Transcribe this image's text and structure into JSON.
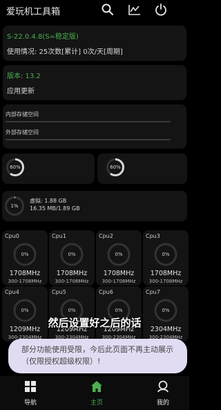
{
  "header": {
    "title": "爱玩机工具箱",
    "icons": [
      "search-icon",
      "chart-icon",
      "power-icon"
    ]
  },
  "info_card": {
    "version_line": "S-22.0.4.8(S=稳定版)",
    "usage_line": "使用情况: 25次数[累计] 0次/天[周期]"
  },
  "version_card": {
    "version": "版本: 13.2",
    "update": "应用更新"
  },
  "storage": {
    "internal_label": "内部存储空间",
    "external_label": "外部存储空间"
  },
  "usage_cards": {
    "left_percent": "60%",
    "right_percent": "60%"
  },
  "memory": {
    "percent": "1%",
    "virtual": "虚拟: 1.88 GB",
    "ram": "16.35 MB/1.89 GB"
  },
  "cpus": [
    {
      "name": "Cpu0",
      "load": "0%",
      "freq": "1708MHz",
      "range": "300-1708MHz"
    },
    {
      "name": "Cpu1",
      "load": "0%",
      "freq": "1708MHz",
      "range": "300-1708MHz"
    },
    {
      "name": "Cpu2",
      "load": "0%",
      "freq": "1708MHz",
      "range": "300-1708MHz"
    },
    {
      "name": "Cpu3",
      "load": "0%",
      "freq": "1708MHz",
      "range": "300-1708MHz"
    },
    {
      "name": "Cpu4",
      "load": "0%",
      "freq": "1209MHz",
      "range": "300-2304MHz"
    },
    {
      "name": "Cpu5",
      "load": "0%",
      "freq": "1209MHz",
      "range": "300-2304MHz"
    },
    {
      "name": "Cpu6",
      "load": "0%",
      "freq": "1209MHz",
      "range": "300-2304MHz"
    },
    {
      "name": "Cpu7",
      "load": "0%",
      "freq": "2304MHz",
      "range": "300-2304MHz"
    }
  ],
  "subtitle": "然后设置好之后的话",
  "toast": "部分功能使用受限，今后此页面不再主动展示（仅限授权超级权限）!",
  "bottom_nav": [
    {
      "label": "导航",
      "icon": "grid-icon"
    },
    {
      "label": "主页",
      "icon": "home-icon"
    },
    {
      "label": "我的",
      "icon": "profile-icon"
    }
  ],
  "colors": {
    "accent": "#4caf50",
    "background": "#000000",
    "card": "#141414",
    "toast": "#e2dcf3"
  }
}
